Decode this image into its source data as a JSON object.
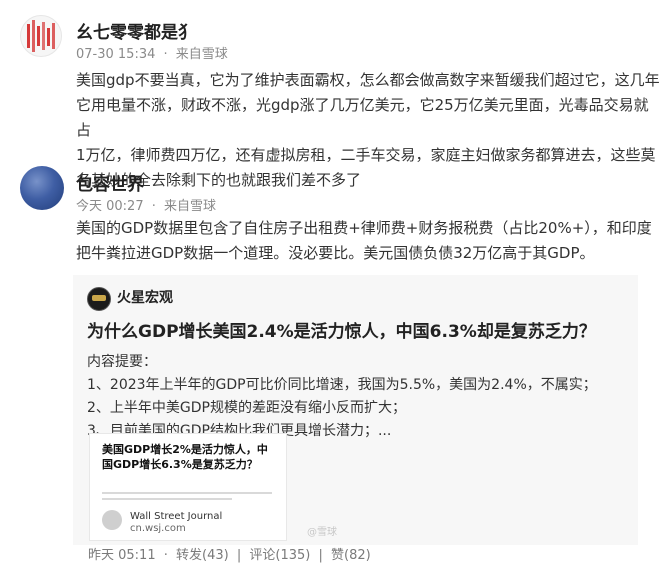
{
  "comment1": {
    "user": "幺七零零都是犭",
    "date": "07-30 15:34",
    "source": "来自雪球",
    "text": [
      "美国gdp不要当真，它为了维护表面霸权，怎么都会做高数字来暂缓我们超过它，这几年",
      "它用电量不涨，财政不涨，光gdp涨了几万亿美元，它25万亿美元里面，光毒品交易就占",
      "1万亿，律师费四万亿，还有虚拟房租，二手车交易，家庭主妇做家务都算进去，这些莫",
      "名其妙的全去除剩下的也就跟我们差不多了"
    ]
  },
  "comment2": {
    "user": "包容世界",
    "date": "今天 00:27",
    "source": "来自雪球",
    "text": [
      "美国的GDP数据里包含了自住房子出租费+律师费+财务报税费（占比20%+），和印度",
      "把牛粪拉进GDP数据一个道理。没必要比。美元国债负债32万亿高于其GDP。"
    ]
  },
  "quoted": {
    "author": "火星宏观",
    "title": "为什么GDP增长美国2.4%是活力惊人，中国6.3%却是复苏乏力？",
    "summary_label": "内容提要：",
    "points": [
      "1、2023年上半年的GDP可比价同比增速，我国为5.5%，美国为2.4%，不属实；",
      "2、上半年中美GDP规模的差距没有缩小反而扩大；",
      "3、目前美国的GDP结构比我们更具增长潜力；..."
    ],
    "thumbnail": {
      "title": "美国GDP增长2%是活力惊人，中国GDP增长6.3%是复苏乏力？",
      "source": "Wall Street Journal",
      "domain": "cn.wsj.com"
    },
    "watermark": "@雪球"
  },
  "actions": {
    "time": "昨天 05:11",
    "repost": "转发(43)",
    "comment": "评论(135)",
    "like": "赞(82)"
  }
}
